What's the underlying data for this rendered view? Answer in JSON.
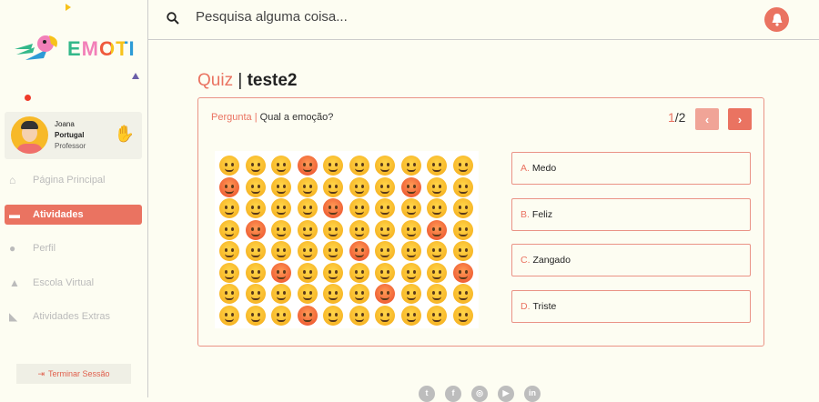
{
  "brand": {
    "name": "EMOTI",
    "letter_colors": [
      "#33b88a",
      "#f27fb8",
      "#ef5a3c",
      "#f7c21a",
      "#2d9bd6"
    ]
  },
  "user": {
    "first_name": "Joana",
    "last_name": "Portugal",
    "role": "Professor"
  },
  "sidebar": {
    "items": [
      {
        "label": "Página Principal",
        "icon": "home-icon",
        "active": false
      },
      {
        "label": "Atividades",
        "icon": "gamepad-icon",
        "active": true
      },
      {
        "label": "Perfil",
        "icon": "user-icon",
        "active": false
      },
      {
        "label": "Escola Virtual",
        "icon": "graduation-cap-icon",
        "active": false
      },
      {
        "label": "Atividades Extras",
        "icon": "chart-icon",
        "active": false
      }
    ],
    "logout_label": "Terminar Sessão"
  },
  "header": {
    "search_placeholder": "Pesquisa alguma coisa...",
    "notification_icon": "bell-icon"
  },
  "quiz": {
    "label": "Quiz",
    "separator": "|",
    "name": "teste2",
    "question_label": "Pergunta",
    "question": "Qual a emoção?",
    "current": "1",
    "total": "/2",
    "answers": [
      {
        "letter": "A.",
        "text": "Medo"
      },
      {
        "letter": "B.",
        "text": "Feliz"
      },
      {
        "letter": "C.",
        "text": "Zangado"
      },
      {
        "letter": "D.",
        "text": "Triste"
      }
    ]
  },
  "footer": {
    "social": [
      {
        "name": "twitter-icon",
        "glyph": "t"
      },
      {
        "name": "facebook-icon",
        "glyph": "f"
      },
      {
        "name": "instagram-icon",
        "glyph": "◎"
      },
      {
        "name": "youtube-icon",
        "glyph": "▶"
      },
      {
        "name": "linkedin-icon",
        "glyph": "in"
      }
    ]
  },
  "colors": {
    "accent": "#ea7361",
    "accent_light": "#f0a497",
    "background": "#fdfdf2"
  }
}
